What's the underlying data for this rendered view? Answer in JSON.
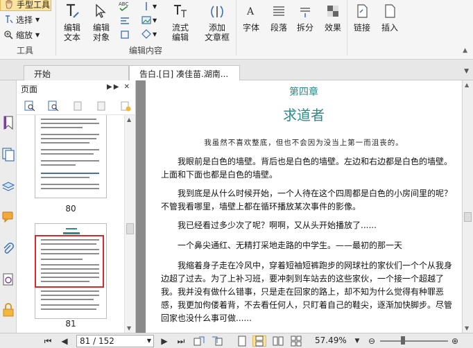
{
  "ribbon": {
    "tools_group": {
      "hand_tool": "手型工具",
      "select": "选择",
      "zoom": "缩放",
      "label": "工具"
    },
    "edit_group": {
      "edit_text": "编辑\n文本",
      "edit_object": "编辑\n对象",
      "flow_edit": "流式\n编辑",
      "add_textbox": "添加\n文章框",
      "label": "编辑内容"
    },
    "format_buttons": {
      "font": "字体",
      "paragraph": "段落",
      "split": "拆分",
      "effect": "效果",
      "link": "链接",
      "insert": "插入"
    }
  },
  "tabs": [
    {
      "label": "开始"
    },
    {
      "label": "告白.[日] 凑佳苗.湖南..."
    }
  ],
  "panel": {
    "title": "页面",
    "thumbnails": [
      {
        "page": "80"
      },
      {
        "page": "81"
      }
    ]
  },
  "document": {
    "chapter_number": "第四章",
    "chapter_title": "求道者",
    "epigraph": "我虽然不喜欢整底，但也不会因为没当上第一而沮丧的。",
    "paragraphs": [
      "我眼前是白色的墙壁。背后也是白色的墙壁。左边和右边都是白色的墙壁。上面和下面也都是白色的墙壁。",
      "我到底是从什么时候开始，一个人待在这个四周都是白色的小房间里的呢？不管我看哪里，墙壁上都在循环播放某次事件的影像。",
      "我已经看过多少次了呢？啊啊，又从头开始播放了......",
      "一个鼻尖通红、无精打采地走路的中学生。——最初的那一天",
      "我缩着身子走在冷风中，穿着短袖短裤跑步的网球社的家伙们一个个从我身边超了过去。为了上补习班，要冲刺到车站去的这些家伙，一个接一个超越了我。我并没有做什么错事，只是走在回家的路上，却不知为什么觉得有种罪恶感，我更加佝偻着背，不去看任何人，只盯着自己的鞋尖，逐渐加快脚步。尽管回家也没什么事可做......"
    ]
  },
  "status": {
    "page_display": "81 / 152",
    "zoom": "57.49%"
  },
  "colors": {
    "accent_teal": "#2e8a86",
    "thumb_highlight": "#d62a2a",
    "active_tool_bg": "#fbe3a0"
  }
}
